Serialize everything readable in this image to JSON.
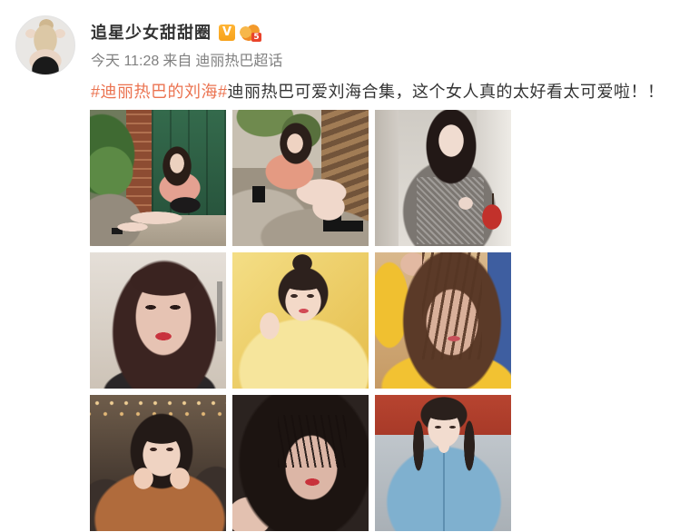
{
  "post": {
    "author": {
      "name": "追星少女甜甜圈",
      "verified_badge": "V",
      "level_badge": "5"
    },
    "meta": {
      "time": "今天 11:28",
      "from_label": "来自",
      "source": "迪丽热巴超话"
    },
    "content": {
      "hashtag": "#迪丽热巴的刘海#",
      "text": "迪丽热巴可爱刘海合集，这个女人真的太好看太可爱啦！！"
    }
  },
  "icons": {
    "verified": "verified-v-icon",
    "member_level": "member-level-icon"
  },
  "colors": {
    "hashtag": "#eb7350",
    "username": "#333333",
    "meta": "#808080",
    "verified": "#f7a21b"
  }
}
